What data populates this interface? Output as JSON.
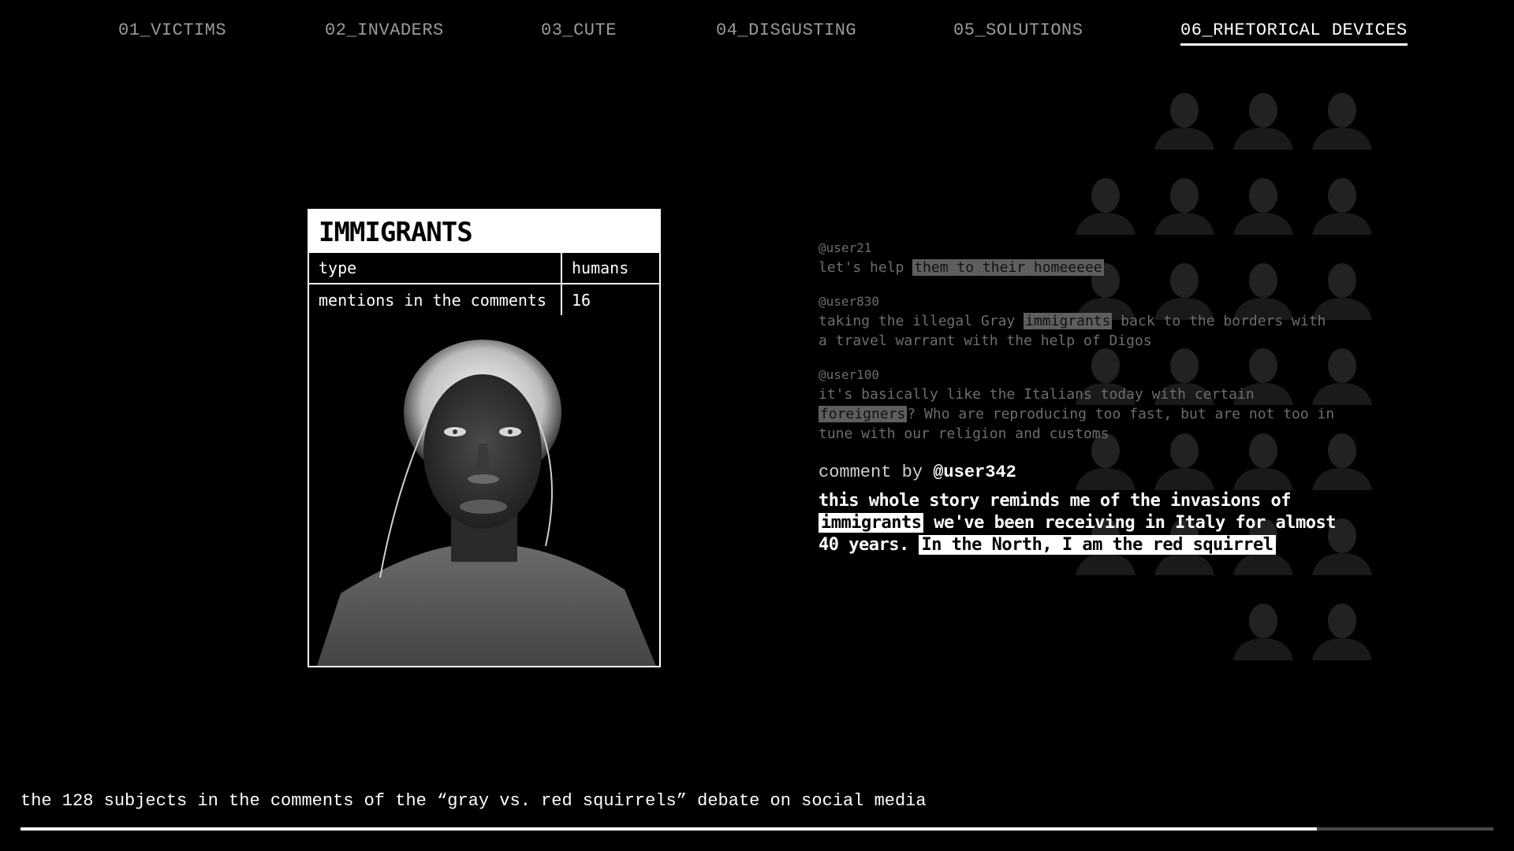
{
  "nav": {
    "tabs": [
      {
        "label": "01_VICTIMS"
      },
      {
        "label": "02_INVADERS"
      },
      {
        "label": "03_CUTE"
      },
      {
        "label": "04_DISGUSTING"
      },
      {
        "label": "05_SOLUTIONS"
      },
      {
        "label": "06_RHETORICAL DEVICES",
        "active": true
      }
    ]
  },
  "card": {
    "title": "IMMIGRANTS",
    "rows": [
      {
        "key": "type",
        "value": "humans"
      },
      {
        "key": "mentions in the comments",
        "value": "16"
      }
    ]
  },
  "comments": [
    {
      "user": "@user21",
      "before": "let's help ",
      "highlight": "them to their homeeeee",
      "after": ""
    },
    {
      "user": "@user830",
      "before": "taking the illegal Gray ",
      "highlight": "immigrants",
      "after": " back to the borders with a travel warrant with the help of Digos"
    },
    {
      "user": "@user100",
      "before": "it's basically like the Italians today with certain ",
      "highlight": "foreigners",
      "after": "? Who are reproducing too fast, but are not too in tune with our religion and customs"
    }
  ],
  "main_comment": {
    "by_label": "comment by",
    "user": "@user342",
    "before": "this whole story reminds me of the invasions of ",
    "highlight": "immigrants",
    "middle": " we've been receiving in Italy for almost 40 years. ",
    "highlight2": "In the North, I am the red squirrel"
  },
  "footer": {
    "caption": "the 128 subjects in the comments of the “gray vs. red squirrels” debate on social media",
    "progress_fraction": 0.88
  },
  "colors": {
    "background": "#000000",
    "text": "#ffffff",
    "dim_text": "#6d6d6d",
    "highlight": "#ffffff"
  }
}
